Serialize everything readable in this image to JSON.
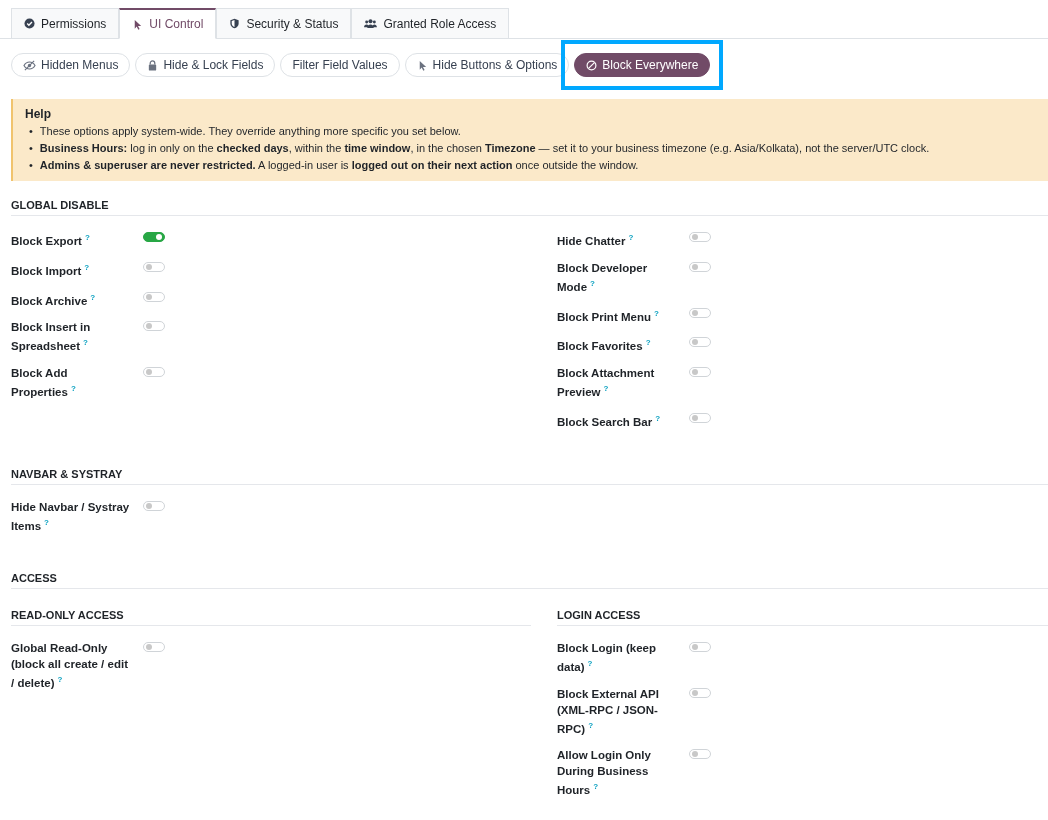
{
  "tabs": [
    {
      "label": "Permissions",
      "kind": "check",
      "selected": false
    },
    {
      "label": "UI Control",
      "kind": "pointer",
      "selected": true
    },
    {
      "label": "Security & Status",
      "kind": "shield",
      "selected": false
    },
    {
      "label": "Granted Role Access",
      "kind": "users",
      "selected": false
    }
  ],
  "subtabs": [
    {
      "label": "Hidden Menus",
      "kind": "hidden",
      "selected": false,
      "highlighted": false
    },
    {
      "label": "Hide & Lock Fields",
      "kind": "lock",
      "selected": false,
      "highlighted": false
    },
    {
      "label": "Filter Field Values",
      "kind": "plain",
      "selected": false,
      "highlighted": false
    },
    {
      "label": "Hide Buttons & Options",
      "kind": "pointer",
      "selected": false,
      "highlighted": false
    },
    {
      "label": "Block Everywhere",
      "kind": "ban",
      "selected": true,
      "highlighted": true
    }
  ],
  "help": {
    "title": "Help",
    "items": [
      {
        "bullet": "•",
        "text": "These options apply system-wide. They override anything more specific you set below."
      },
      {
        "bullet": "•",
        "text": "**Business Hours:** log in only on the **checked days**, within the **time window**, in the chosen **Timezone** — set it to your business timezone (e.g. Asia/Kolkata), not the server/UTC clock."
      },
      {
        "bullet": "•",
        "text": "**Admins & superuser are never restricted.** A logged-in user is **logged out on their next action** once outside the window."
      }
    ]
  },
  "sections": [
    {
      "title": "GLOBAL DISABLE",
      "columns": [
        {
          "fields": [
            {
              "label": "Block Export",
              "hint": "?",
              "on": true
            },
            {
              "label": "Block Import",
              "hint": "?",
              "on": false
            },
            {
              "label": "Block Archive",
              "hint": "?",
              "on": false
            },
            {
              "label": "Block Insert in Spreadsheet",
              "hint": "?",
              "on": false
            },
            {
              "label": "Block Add Properties",
              "hint": "?",
              "on": false
            }
          ]
        },
        {
          "fields": [
            {
              "label": "Hide Chatter",
              "hint": "?",
              "on": false
            },
            {
              "label": "Block Developer Mode",
              "hint": "?",
              "on": false
            },
            {
              "label": "Block Print Menu",
              "hint": "?",
              "on": false
            },
            {
              "label": "Block Favorites",
              "hint": "?",
              "on": false
            },
            {
              "label": "Block Attachment Preview",
              "hint": "?",
              "on": false
            },
            {
              "label": "Block Search Bar",
              "hint": "?",
              "on": false
            }
          ]
        }
      ]
    },
    {
      "title": "NAVBAR & SYSTRAY",
      "columns": [
        {
          "fields": [
            {
              "label": "Hide Navbar / Systray Items",
              "hint": "?",
              "on": false
            }
          ]
        }
      ]
    },
    {
      "title": "ACCESS",
      "columns": [
        {
          "title": "READ-ONLY ACCESS",
          "fields": [
            {
              "label": "Global Read-Only (block all create / edit / delete)",
              "hint": "?",
              "on": false
            }
          ]
        },
        {
          "title": "LOGIN ACCESS",
          "fields": [
            {
              "label": "Block Login (keep data)",
              "hint": "?",
              "on": false
            },
            {
              "label": "Block External API (XML-RPC / JSON-RPC)",
              "hint": "?",
              "on": false
            },
            {
              "label": "Allow Login Only During Business Hours",
              "hint": "?",
              "on": false
            }
          ]
        }
      ]
    }
  ]
}
